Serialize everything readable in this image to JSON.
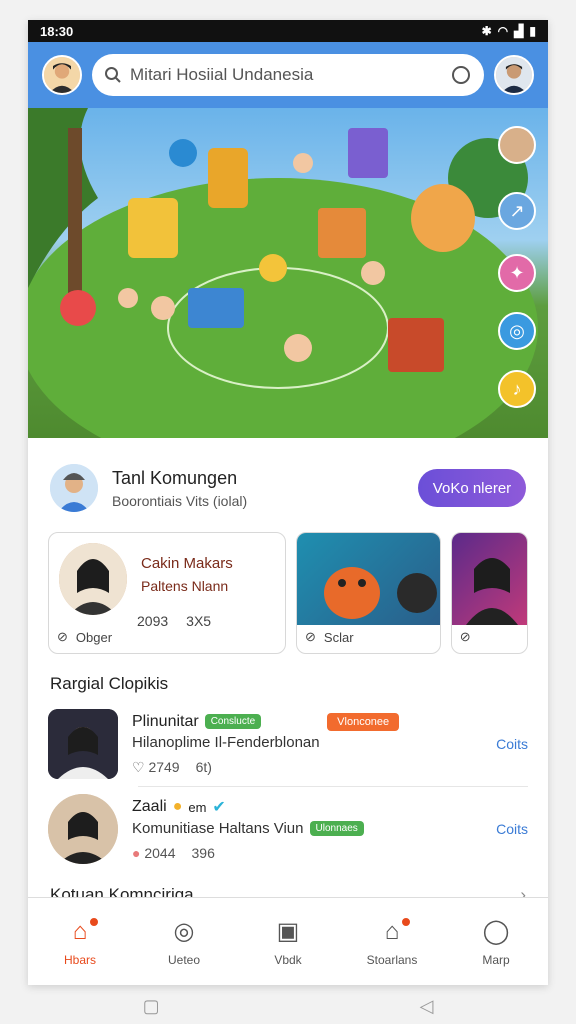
{
  "status": {
    "time": "18:30",
    "icons": [
      "bluetooth-icon",
      "wifi-icon",
      "signal-icon",
      "battery-icon"
    ]
  },
  "search": {
    "placeholder": "Mitari Hosiial Undanesia"
  },
  "profile": {
    "name": "Tanl Komungen",
    "subtitle": "Boorontiais Vits (iolal)",
    "follow_label": "VoKo nlerer"
  },
  "cards": [
    {
      "title": "Cakin Makars",
      "subtitle": "Paltens Nlann",
      "stat1": "2093",
      "stat2": "3X5",
      "footer": "Obger"
    },
    {
      "footer": "Sclar"
    },
    {}
  ],
  "section_title": "Rargial Clopikis",
  "list": [
    {
      "title": "Plinunitar",
      "tag_green": "Conslucte",
      "desc": "Hilanoplime Il-Fenderblonan",
      "tag_orange": "Vlonconee",
      "likes": "2749",
      "count": "6t)",
      "action": "Coits"
    },
    {
      "title": "Zaali",
      "title_extra": "em",
      "desc": "Komunitiase Haltans Viun",
      "tag_green": "Ulonnaes",
      "likes": "2044",
      "count": "396",
      "action": "Coits"
    }
  ],
  "more": {
    "label": "Kotuan Komnciriga"
  },
  "tabs": [
    {
      "label": "Hbars",
      "icon": "home-icon",
      "active": true
    },
    {
      "label": "Ueteo",
      "icon": "compass-icon"
    },
    {
      "label": "Vbdk",
      "icon": "calendar-icon"
    },
    {
      "label": "Stoarlans",
      "icon": "store-icon"
    },
    {
      "label": "Marp",
      "icon": "profile-icon"
    }
  ],
  "colors": {
    "header": "#4a90e2",
    "accent": "#e84a1c",
    "follow": "#7b52d9",
    "link": "#3a7bd5"
  }
}
